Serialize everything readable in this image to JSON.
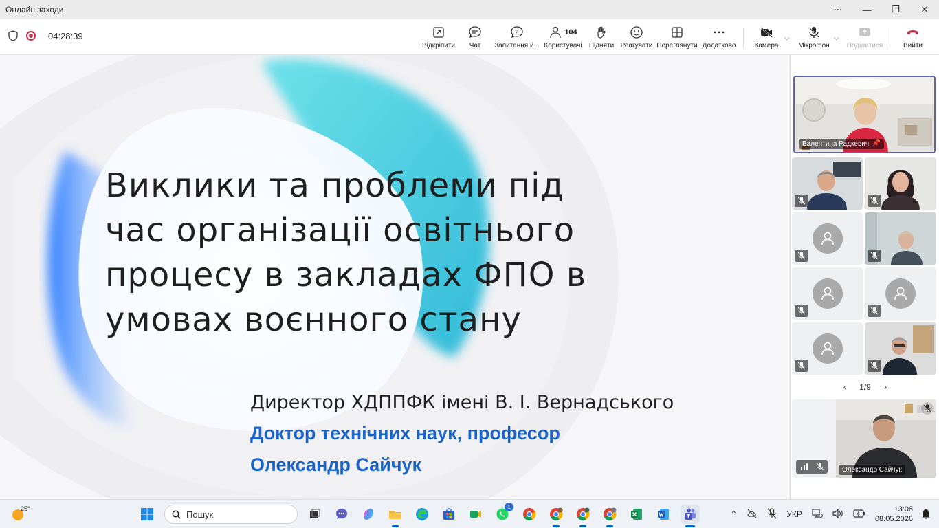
{
  "window": {
    "title": "Онлайн заходи"
  },
  "meeting": {
    "timer": "04:28:39"
  },
  "toolbar": {
    "popout_label": "Відкріпити",
    "chat_label": "Чат",
    "qa_label": "Запитання й...",
    "people_label": "Користувачі",
    "people_count": "104",
    "raise_label": "Підняти",
    "react_label": "Реагувати",
    "view_label": "Переглянути",
    "more_label": "Додатково",
    "camera_label": "Камера",
    "mic_label": "Мікрофон",
    "share_label": "Поділитися",
    "leave_label": "Вийти"
  },
  "slide": {
    "title": "Виклики та проблеми під час організації освітнього процесу в закладах ФПО в умовах воєнного стану",
    "line1": "Директор ХДППФК імені В. І. Вернадського",
    "line2": "Доктор технічних наук, професор",
    "line3": "Олександр Сайчук",
    "colors": {
      "blue": "#1a64c8",
      "cyan": "#22c8d8"
    }
  },
  "participants": {
    "featured_name": "Валентина Радкевич",
    "pager": "1/9",
    "self_name": "Олександр Сайчук"
  },
  "taskbar": {
    "temperature": "25°",
    "search_placeholder": "Пошук",
    "whatsapp_badge": "1",
    "language": "УКР",
    "time": "13:08",
    "date": "08.05.2026"
  }
}
